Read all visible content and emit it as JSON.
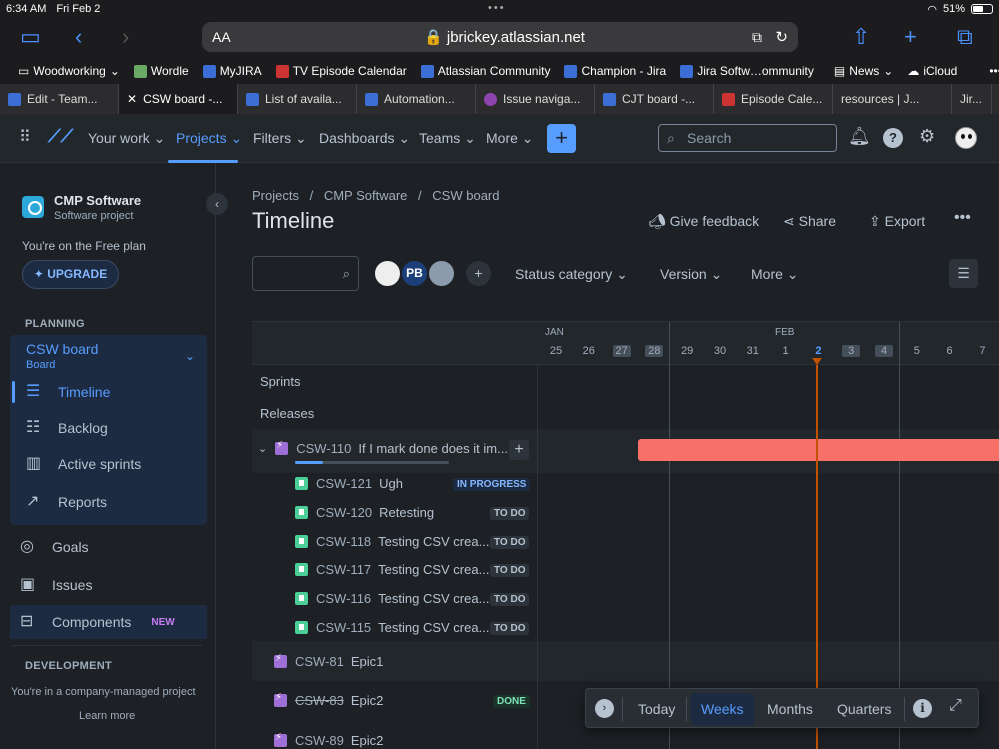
{
  "status_bar": {
    "time": "6:34 AM",
    "date": "Fri Feb 2",
    "battery": "51%"
  },
  "browser": {
    "text_size_label": "AA",
    "url": "jbrickey.atlassian.net",
    "bookmarks": [
      "Woodworking",
      "Wordle",
      "MyJIRA",
      "TV Episode Calendar",
      "Atlassian Community",
      "Champion - Jira",
      "Jira Softw…ommunity",
      "News",
      "iCloud"
    ],
    "tabs": [
      "Edit - Team...",
      "CSW board -...",
      "List of availa...",
      "Automation...",
      "Issue naviga...",
      "CJT board -...",
      "Episode Cale...",
      "resources | J...",
      "Jir..."
    ]
  },
  "nav": {
    "items": [
      "Your work",
      "Projects",
      "Filters",
      "Dashboards",
      "Teams",
      "More"
    ],
    "search_placeholder": "Search"
  },
  "sidebar": {
    "project_name": "CMP Software",
    "project_type": "Software project",
    "plan_text": "You're on the Free plan",
    "upgrade_label": "UPGRADE",
    "planning_heading": "PLANNING",
    "board_name": "CSW board",
    "board_type": "Board",
    "board_items": [
      "Timeline",
      "Backlog",
      "Active sprints",
      "Reports"
    ],
    "other_items": [
      "Goals",
      "Issues",
      "Components"
    ],
    "new_label": "NEW",
    "development_heading": "DEVELOPMENT",
    "managed_text": "You're in a company-managed project",
    "learn_more": "Learn more"
  },
  "main": {
    "breadcrumbs": [
      "Projects",
      "CMP Software",
      "CSW board"
    ],
    "title": "Timeline",
    "actions": [
      "Give feedback",
      "Share",
      "Export"
    ],
    "avatar_initials": "PB",
    "filters": [
      "Status category",
      "Version",
      "More"
    ]
  },
  "timeline": {
    "months": [
      "JAN",
      "FEB"
    ],
    "days": [
      "25",
      "26",
      "27",
      "28",
      "29",
      "30",
      "31",
      "1",
      "2",
      "3",
      "4",
      "5",
      "6",
      "7"
    ],
    "rows": [
      "Sprints",
      "Releases"
    ],
    "parent_epic": {
      "key": "CSW-110",
      "summary": "If I mark done does it im...",
      "progress": 0.18
    },
    "children": [
      {
        "key": "CSW-121",
        "summary": "Ugh",
        "status": "IN PROGRESS"
      },
      {
        "key": "CSW-120",
        "summary": "Retesting",
        "status": "TO DO"
      },
      {
        "key": "CSW-118",
        "summary": "Testing CSV crea...",
        "status": "TO DO"
      },
      {
        "key": "CSW-117",
        "summary": "Testing CSV crea...",
        "status": "TO DO"
      },
      {
        "key": "CSW-116",
        "summary": "Testing CSV crea...",
        "status": "TO DO"
      },
      {
        "key": "CSW-115",
        "summary": "Testing CSV crea...",
        "status": "TO DO"
      }
    ],
    "epics": [
      {
        "key": "CSW-81",
        "summary": "Epic1",
        "status": ""
      },
      {
        "key": "CSW-83",
        "summary": "Epic2",
        "status": "DONE"
      },
      {
        "key": "CSW-89",
        "summary": "Epic2",
        "status": ""
      }
    ]
  },
  "view_controls": {
    "today": "Today",
    "weeks": "Weeks",
    "months": "Months",
    "quarters": "Quarters"
  }
}
